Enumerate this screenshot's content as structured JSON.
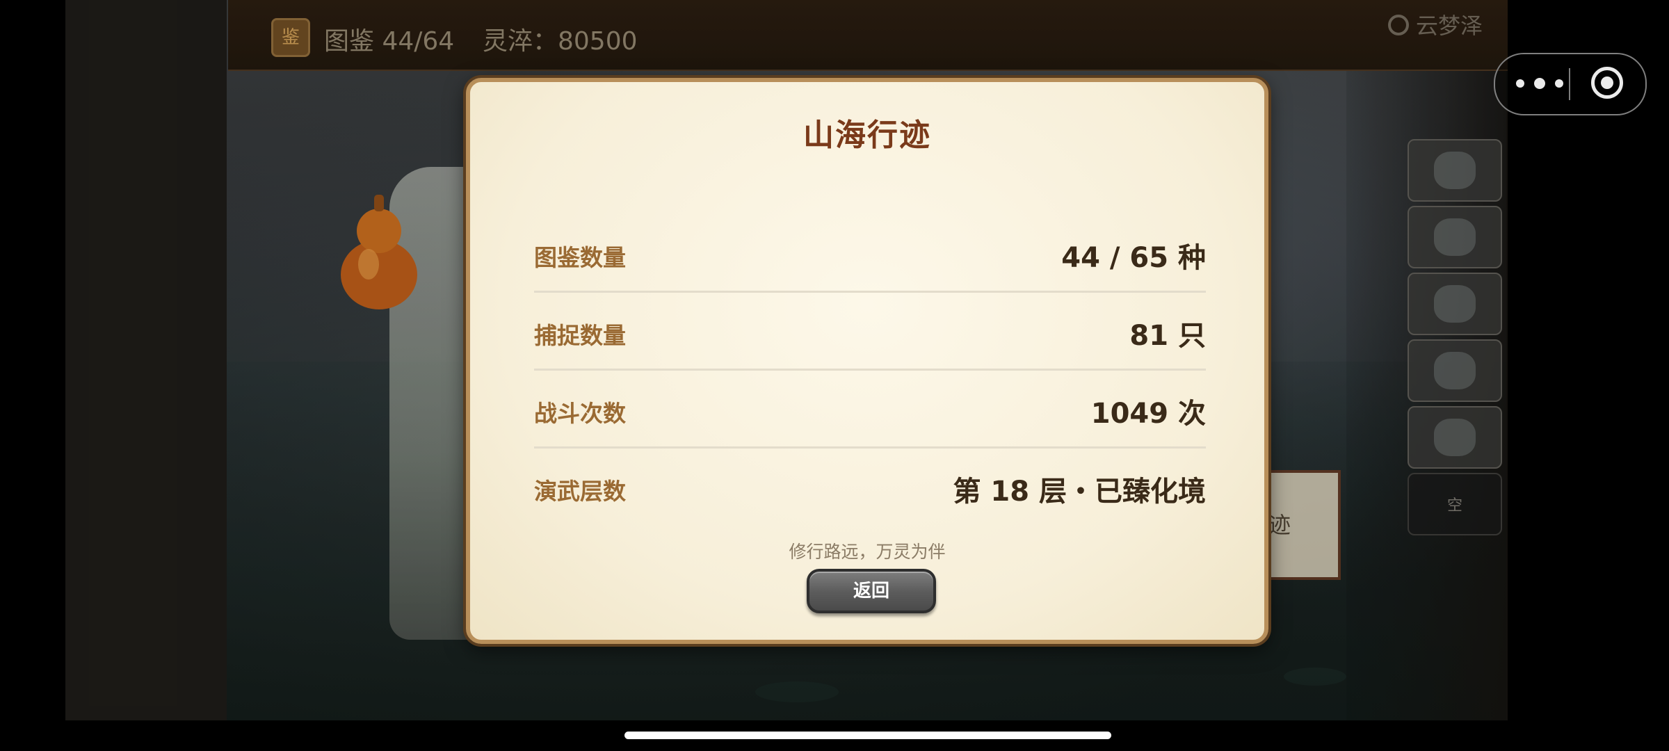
{
  "topbar": {
    "badge": "鉴",
    "codex": "图鉴 44/64",
    "essence": "灵淬：80500",
    "region": "云梦泽"
  },
  "slots": [
    {
      "name": "creature-slot-1",
      "label": ""
    },
    {
      "name": "creature-slot-2",
      "label": ""
    },
    {
      "name": "creature-slot-3",
      "label": ""
    },
    {
      "name": "creature-slot-4",
      "label": ""
    },
    {
      "name": "creature-slot-5",
      "label": ""
    },
    {
      "name": "creature-slot-empty",
      "label": "空"
    }
  ],
  "scroll_bg_text": "迹",
  "dialog": {
    "title": "山海行迹",
    "rows": [
      {
        "label": "图鉴数量",
        "value": "44 / 65 种"
      },
      {
        "label": "捕捉数量",
        "value": "81 只"
      },
      {
        "label": "战斗次数",
        "value": "1049 次"
      },
      {
        "label": "演武层数",
        "value": "第 18 层・已臻化境"
      }
    ],
    "motto": "修行路远，万灵为伴",
    "back_label": "返回"
  }
}
